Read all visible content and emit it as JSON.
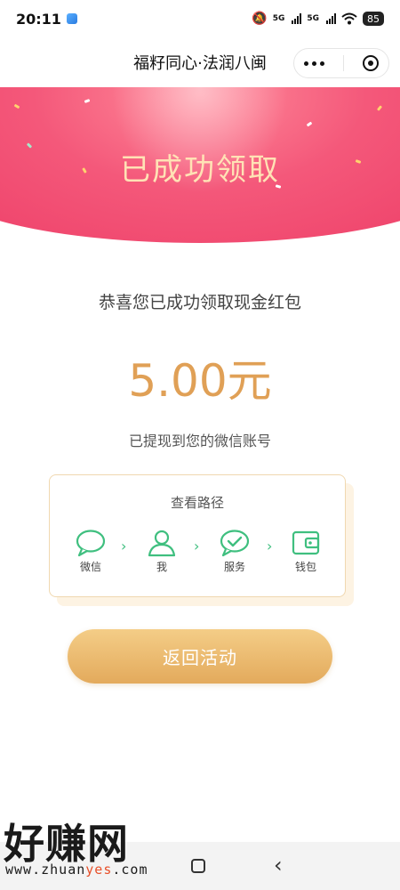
{
  "status_bar": {
    "time": "20:11",
    "network_1": "5G",
    "network_2": "5G",
    "battery": "85"
  },
  "header": {
    "title": "福籽同心·法润八闽",
    "more_icon": "more-dots-icon",
    "close_icon": "target-icon"
  },
  "banner": {
    "title": "已成功领取",
    "colors": {
      "primary": "#ee3f68",
      "title": "#ffe2b5"
    }
  },
  "result": {
    "congrats": "恭喜您已成功领取现金红包",
    "amount": "5.00元",
    "withdrawn_note": "已提现到您的微信账号",
    "amount_color": "#e0a056"
  },
  "path_card": {
    "title": "查看路径",
    "steps": [
      {
        "label": "微信",
        "icon": "chat-bubble-icon"
      },
      {
        "label": "我",
        "icon": "person-icon"
      },
      {
        "label": "服务",
        "icon": "check-bubble-icon"
      },
      {
        "label": "钱包",
        "icon": "wallet-icon"
      }
    ],
    "accent_color": "#3fbf7f"
  },
  "actions": {
    "return_label": "返回活动"
  },
  "watermark": {
    "text": "好赚网",
    "url_prefix": "www.zhuan",
    "url_highlight": "yes",
    "url_suffix": ".com"
  }
}
